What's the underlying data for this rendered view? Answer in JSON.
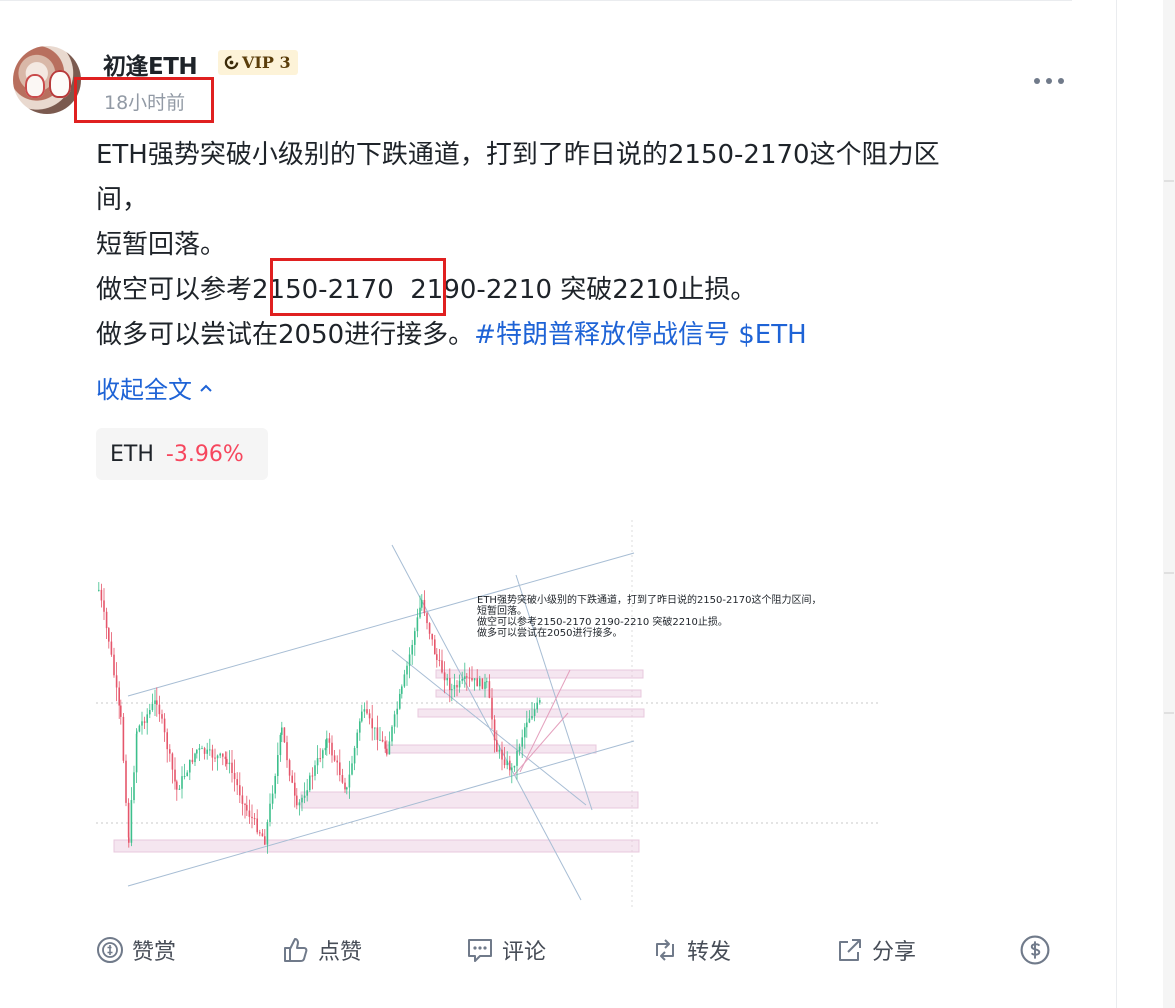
{
  "post": {
    "author": "初逢ETH",
    "vip": "VIP 3",
    "timestamp": "18小时前",
    "body": {
      "line1": "ETH强势突破小级别的下跌通道，打到了昨日说的2150-2170这个阻力区",
      "line2": "间，",
      "line3": "短暂回落。",
      "line4_prefix": "做空可以参考",
      "line4_highlight": "2150-2170",
      "line4_suffix": "  2190-2210 突破2210止损。",
      "line5_text": "做多可以尝试在2050进行接多。",
      "hashtag": "#特朗普释放停战信号",
      "cashtag": "$ETH"
    },
    "collapse_label": "收起全文",
    "ticker": {
      "symbol": "ETH",
      "change": "-3.96%",
      "change_color": "#f6465d"
    },
    "chart_caption": {
      "line1": "ETH强势突破小级别的下跌通道，打到了昨日说的2150-2170这个阻力区间，",
      "line2": "短暂回落。",
      "line3": "做空可以参考2150-2170  2190-2210 突破2210止损。",
      "line4": "做多可以尝试在2050进行接多。"
    }
  },
  "actions": {
    "tip": "赞赏",
    "like": "点赞",
    "comment": "评论",
    "repost": "转发",
    "share": "分享"
  },
  "colors": {
    "link": "#1e63d6",
    "highlight_border": "#e02020",
    "candle_up": "#3dbf8c",
    "candle_down": "#e5566b",
    "zone": "#e8c8de"
  }
}
